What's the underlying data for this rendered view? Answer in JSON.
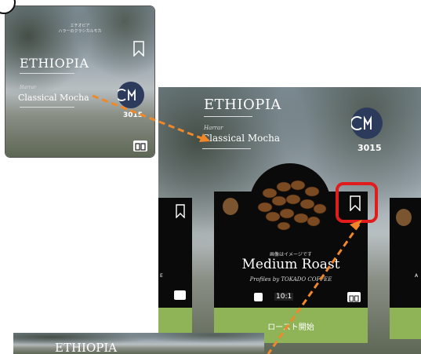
{
  "step_badge": "",
  "small_card": {
    "subtitle": "エチオピア\nハラーのクラシカルモカ",
    "country": "ETHIOPIA",
    "origin": "Harrar",
    "name": "Classical Mocha",
    "number": "3015",
    "icons": [
      "bookmark-icon",
      "cm-logo-icon",
      "book-icon"
    ]
  },
  "screen": {
    "country": "ETHIOPIA",
    "origin": "Harrar",
    "name": "Classical Mocha",
    "number": "3015",
    "center_card": {
      "disclaimer": "画像はイメージです",
      "roast": "Medium Roast",
      "profile": "Profiles by TOKADO COFFEE",
      "timer": "10:1",
      "start_button": "ロースト開始"
    },
    "left_card_side_text": "E",
    "right_card_side_text": "A"
  },
  "bottom_card": {
    "country": "ETHIOPIA"
  },
  "colors": {
    "accent_green": "#8fb458",
    "highlight_red": "#e21c1c",
    "arrow_orange": "#f0882a",
    "logo_navy": "#2c3a5c"
  }
}
